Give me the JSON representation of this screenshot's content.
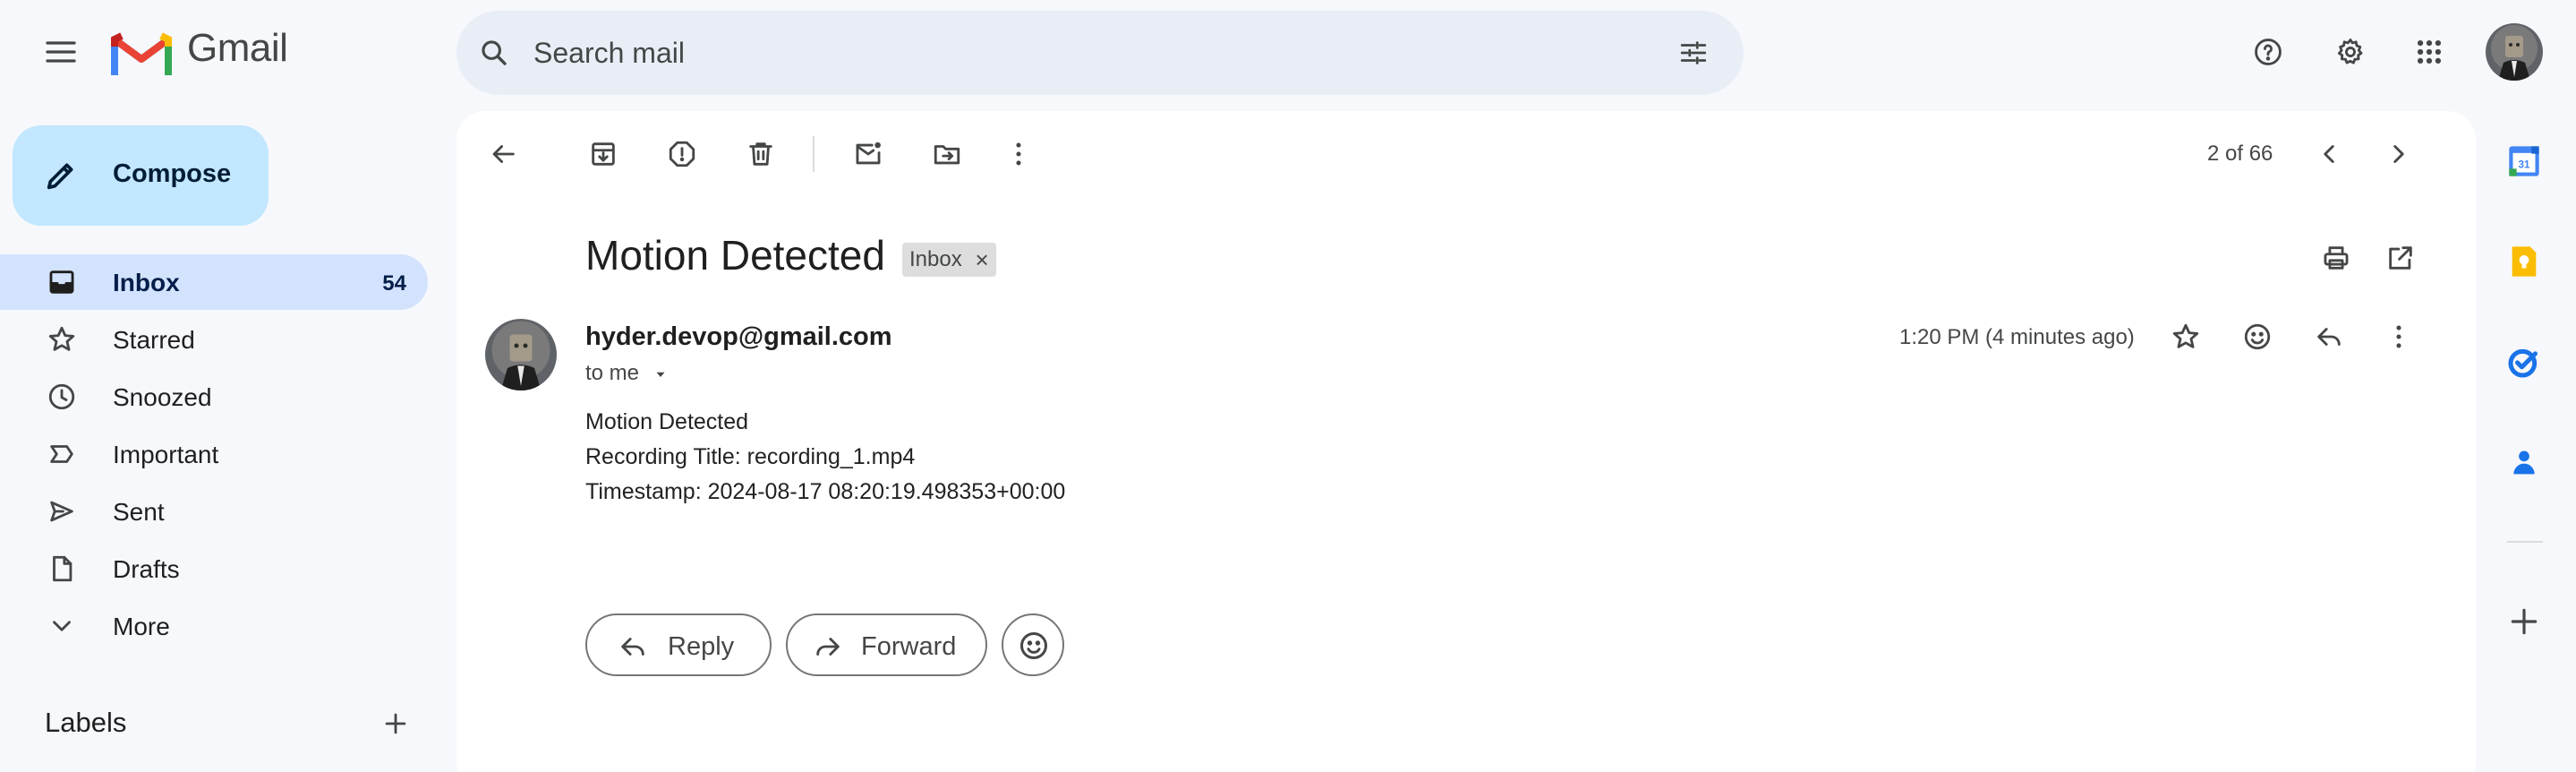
{
  "app": {
    "name": "Gmail",
    "brand_colors": {
      "red": "#ea4335",
      "blue": "#4285f4",
      "green": "#34a853",
      "yellow": "#fbbc04"
    }
  },
  "header": {
    "menu_icon": "hamburger-menu-icon",
    "search": {
      "placeholder": "Search mail",
      "value": "",
      "icon": "search-icon",
      "options_icon": "search-options-icon"
    },
    "actions": [
      "help-icon",
      "settings-gear-icon",
      "apps-grid-icon"
    ]
  },
  "sidebar": {
    "compose_label": "Compose",
    "items": [
      {
        "label": "Inbox",
        "count": "54",
        "icon": "inbox-icon",
        "active": true
      },
      {
        "label": "Starred",
        "count": "",
        "icon": "star-icon",
        "active": false
      },
      {
        "label": "Snoozed",
        "count": "",
        "icon": "clock-icon",
        "active": false
      },
      {
        "label": "Important",
        "count": "",
        "icon": "important-icon",
        "active": false
      },
      {
        "label": "Sent",
        "count": "",
        "icon": "send-icon",
        "active": false
      },
      {
        "label": "Drafts",
        "count": "",
        "icon": "draft-icon",
        "active": false
      },
      {
        "label": "More",
        "count": "",
        "icon": "chevron-down-icon",
        "active": false
      }
    ],
    "labels_title": "Labels"
  },
  "toolbar": {
    "buttons": [
      "back-arrow-icon",
      "archive-icon",
      "report-spam-icon",
      "delete-icon",
      "mark-unread-icon",
      "move-to-icon",
      "more-vert-icon"
    ],
    "pagination": "2 of 66"
  },
  "message": {
    "subject": "Motion Detected",
    "label_chip": "Inbox",
    "chip_close": "×",
    "sender": "hyder.devop@gmail.com",
    "recipient": "to me",
    "time": "1:20 PM (4 minutes ago)",
    "body": [
      "Motion Detected",
      "Recording Title: recording_1.mp4",
      "Timestamp: 2024-08-17 08:20:19.498353+00:00"
    ],
    "reply_label": "Reply",
    "forward_label": "Forward"
  },
  "right_rail": [
    "calendar-icon",
    "keep-icon",
    "tasks-icon",
    "contacts-icon",
    "add-icon"
  ]
}
